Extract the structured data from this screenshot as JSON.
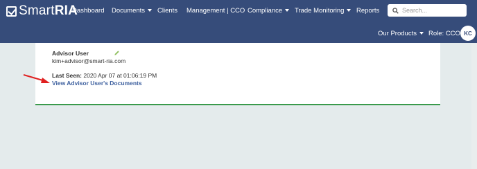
{
  "brand": {
    "name_thin": "Smart",
    "name_bold": "RIA"
  },
  "nav": {
    "items": [
      {
        "label": "Dashboard",
        "dropdown": false
      },
      {
        "label": "Documents",
        "dropdown": true
      },
      {
        "label": "Clients",
        "dropdown": false
      },
      {
        "label": "Management | CCO",
        "dropdown": false
      },
      {
        "label": "Compliance",
        "dropdown": true
      },
      {
        "label": "Trade Monitoring",
        "dropdown": true
      },
      {
        "label": "Reports",
        "dropdown": false
      }
    ],
    "products_label": "Our Products",
    "role_label": "Role: CCO"
  },
  "search": {
    "placeholder": "Search..."
  },
  "user": {
    "initials": "KC"
  },
  "card": {
    "name": "Advisor User",
    "email": "kim+advisor@smart-ria.com",
    "last_seen_label": "Last Seen:",
    "last_seen_value": "2020 Apr 07 at 01:06:19 PM",
    "documents_link": "View Advisor User's Documents"
  },
  "colors": {
    "navbar": "#364c7a",
    "page_background": "#e4ebec",
    "card_border": "#3a9a4c",
    "link": "#3c5f9e",
    "annotation_arrow": "#e02020"
  },
  "icons": [
    "logo-check-icon",
    "search-icon",
    "pencil-icon",
    "caret-down-icon",
    "red-arrow-annotation"
  ]
}
